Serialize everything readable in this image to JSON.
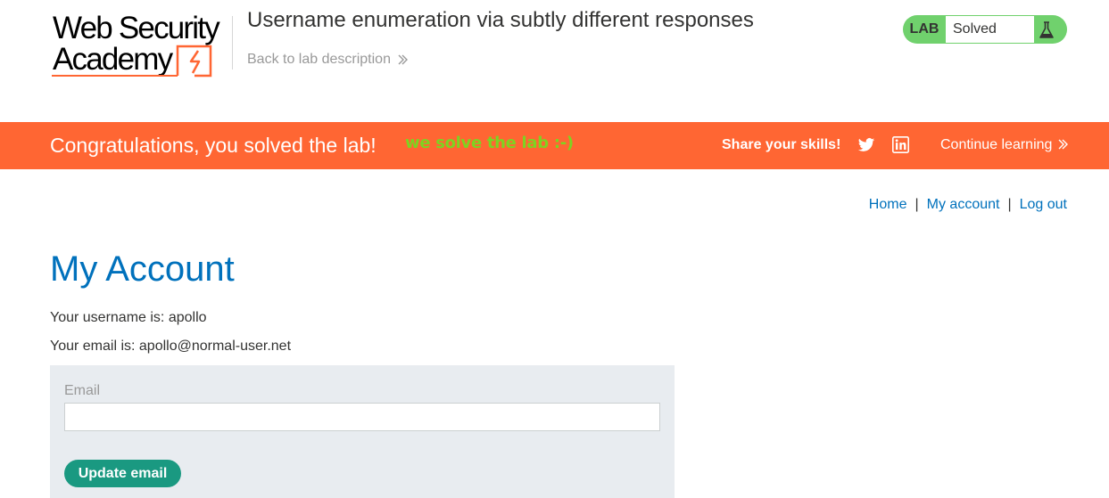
{
  "logo": {
    "line1": "Web Security",
    "line2": "Academy",
    "accent_color": "#ff6633"
  },
  "header": {
    "lab_title": "Username enumeration via subtly different responses",
    "back_link": "Back to lab description"
  },
  "status": {
    "tag": "LAB",
    "value": "Solved",
    "color": "#70d16d",
    "icon": "flask-icon"
  },
  "banner": {
    "message": "Congratulations, you solved the lab!",
    "injected_text": "we solve the lab :-)",
    "share_label": "Share your skills!",
    "continue_label": "Continue learning",
    "background": "#ff6633",
    "icons": [
      "twitter-icon",
      "linkedin-icon"
    ]
  },
  "nav": {
    "home": "Home",
    "separator": "|",
    "my_account": "My account",
    "log_out": "Log out"
  },
  "account": {
    "title": "My Account",
    "username_line": "Your username is: apollo",
    "email_line": "Your email is: apollo@normal-user.net"
  },
  "form": {
    "email_label": "Email",
    "email_value": "",
    "submit_label": "Update email",
    "button_color": "#1a9981"
  }
}
